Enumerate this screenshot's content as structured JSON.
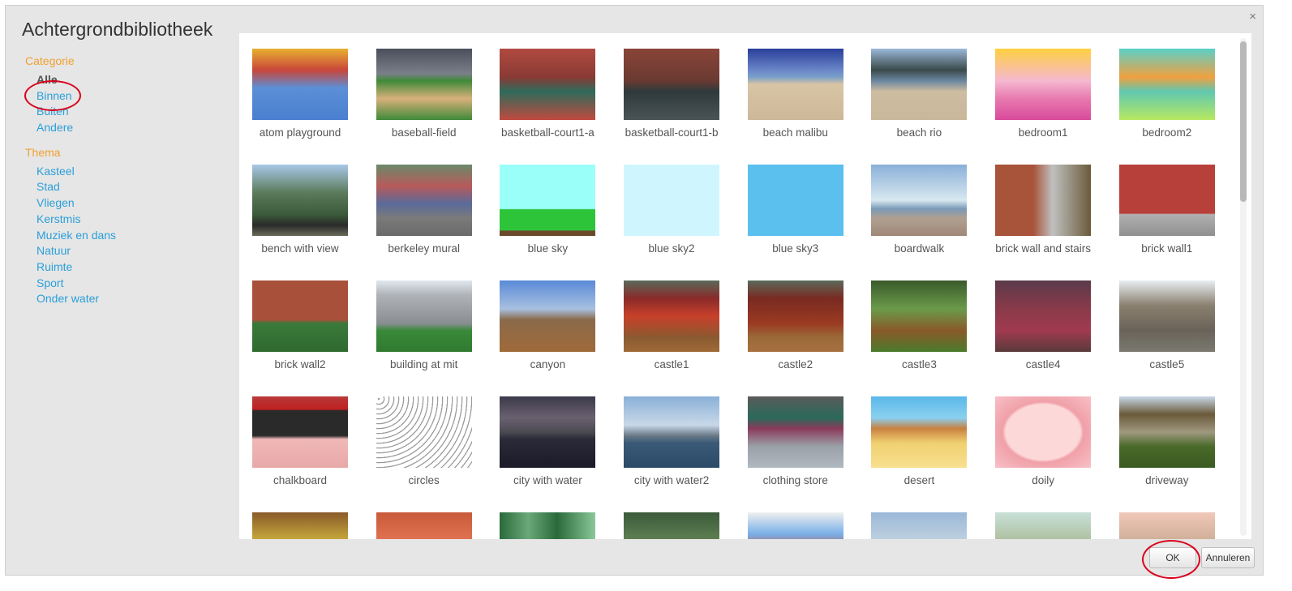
{
  "dialog": {
    "title": "Achtergrondbibliotheek",
    "close_glyph": "×",
    "ok_label": "OK",
    "cancel_label": "Annuleren"
  },
  "sidebar": {
    "category_heading": "Categorie",
    "categories": [
      "Alle",
      "Binnen",
      "Buiten",
      "Andere"
    ],
    "selected_category": "Alle",
    "theme_heading": "Thema",
    "themes": [
      "Kasteel",
      "Stad",
      "Vliegen",
      "Kerstmis",
      "Muziek en dans",
      "Natuur",
      "Ruimte",
      "Sport",
      "Onder water"
    ]
  },
  "icons": {
    "close": "close-icon"
  },
  "colors": {
    "heading_orange": "#f0a030",
    "link_blue": "#2a9fd8",
    "annotation_red": "#d9001b"
  },
  "backdrops": [
    {
      "label": "atom playground",
      "bg": "linear-gradient(180deg,#e8b030 0%,#c9463a 30%,#5b8fd6 55%,#4a7fcf 100%)"
    },
    {
      "label": "baseball-field",
      "bg": "linear-gradient(180deg,#4a4f5c 0%,#7a7f88 35%,#3f8a3a 45%,#d9b07a 70%,#3f8a3a 100%)"
    },
    {
      "label": "basketball-court1-a",
      "bg": "linear-gradient(180deg,#b04a40 0%,#8a3a35 40%,#2e6b5a 60%,#c04a40 100%)"
    },
    {
      "label": "basketball-court1-b",
      "bg": "linear-gradient(180deg,#8a4438 0%,#6a3a32 45%,#2f3a3c 60%,#4a5456 100%)"
    },
    {
      "label": "beach malibu",
      "bg": "linear-gradient(180deg,#2a3f9a 0%,#6a86c8 30%,#7aa0c8 40%,#d8c5a5 50%,#cdb89a 100%)"
    },
    {
      "label": "beach rio",
      "bg": "linear-gradient(180deg,#9ab8d8 0%,#3a4a4a 30%,#6a86a0 45%,#cdbca0 60%,#c8b89a 100%)"
    },
    {
      "label": "bedroom1",
      "bg": "linear-gradient(180deg,#ffd040 0%,#f5b8d0 45%,#e87ab0 70%,#d84a9a 100%)"
    },
    {
      "label": "bedroom2",
      "bg": "linear-gradient(180deg,#5ad0c8 0%,#f0a040 40%,#60c8b0 60%,#b8e860 100%)"
    },
    {
      "label": "bench with view",
      "bg": "linear-gradient(180deg,#a8c8e8 0%,#5a7a5a 40%,#3a5a3a 70%,#2a2a2a 85%,#6a6a5a 100%)"
    },
    {
      "label": "berkeley mural",
      "bg": "linear-gradient(180deg,#6a8a6a 0%,#b85a5a 30%,#5a6a9a 55%,#7a7a7a 75%,#6a6a6a 100%)"
    },
    {
      "label": "blue sky",
      "bg": "linear-gradient(180deg,#9afff8 0%,#9afff8 62%,#2ec43a 63%,#2ec43a 92%,#6a4a2a 93%)"
    },
    {
      "label": "blue sky2",
      "bg": "#cff6ff"
    },
    {
      "label": "blue sky3",
      "bg": "#5bc0ee"
    },
    {
      "label": "boardwalk",
      "bg": "linear-gradient(180deg,#8ab0d8 0%,#d8e8f0 50%,#7a9ab8 62%,#b0a090 75%,#a08878 100%)"
    },
    {
      "label": "brick wall and stairs",
      "bg": "linear-gradient(90deg,#a8543a 0%,#a8543a 40%,#c0c0c0 60%,#6a5a3a 100%)"
    },
    {
      "label": "brick wall1",
      "bg": "linear-gradient(180deg,#b8403a 0%,#b8403a 68%,#b0b0b0 70%,#909090 100%)"
    },
    {
      "label": "brick wall2",
      "bg": "linear-gradient(180deg,#a8503a 0%,#a8503a 55%,#3a7a3a 60%,#2f6a2f 100%)"
    },
    {
      "label": "building at mit",
      "bg": "linear-gradient(180deg,#e0e8f0 0%,#b0b4b8 20%,#8a8e92 60%,#3a8a3a 70%,#2f7a2f 100%)"
    },
    {
      "label": "canyon",
      "bg": "linear-gradient(180deg,#5a8ad8 0%,#a8c0e0 40%,#8a6a4a 55%,#a06a3a 100%)"
    },
    {
      "label": "castle1",
      "bg": "linear-gradient(180deg,#5a6a5a 0%,#8a2a2a 25%,#c8402a 50%,#8a5a30 80%,#a06a38 100%)"
    },
    {
      "label": "castle2",
      "bg": "linear-gradient(180deg,#5a6a5a 0%,#7a2a22 25%,#9a3a22 60%,#9a6a38 80%,#a87040 100%)"
    },
    {
      "label": "castle3",
      "bg": "linear-gradient(180deg,#3a5a2a 0%,#6a9a4a 40%,#8a5a2a 70%,#4a7a2a 100%)"
    },
    {
      "label": "castle4",
      "bg": "linear-gradient(180deg,#5a3a4a 0%,#8a3a4a 40%,#a03a50 70%,#5a3a3a 100%)"
    },
    {
      "label": "castle5",
      "bg": "linear-gradient(180deg,#e8eef2 0%,#8a8070 35%,#6a6258 70%,#7a7a70 100%)"
    },
    {
      "label": "chalkboard",
      "bg": "linear-gradient(180deg,#b83a3a 0%,#c02020 18%,#2a2a2a 20%,#2a2a2a 55%,#f0b8b8 60%,#e8a8a8 100%)"
    },
    {
      "label": "circles",
      "bg": "repeating-radial-gradient(circle at 3px 3px,#999 0,#999 1px,#fff 1.5px,#fff 6px)"
    },
    {
      "label": "city with water",
      "bg": "linear-gradient(180deg,#3a3a4a 0%,#6a6070 30%,#4a4a50 50%,#2a2a38 60%,#1a1a28 100%)"
    },
    {
      "label": "city with water2",
      "bg": "linear-gradient(180deg,#8ab0d8 0%,#c8d8e8 40%,#6a7a88 55%,#3a5a78 65%,#2a4a68 100%)"
    },
    {
      "label": "clothing store",
      "bg": "linear-gradient(180deg,#5a5a5a 0%,#2a6a5a 30%,#8a3a5a 45%,#9aa0a8 70%,#b0b8c0 100%)"
    },
    {
      "label": "desert",
      "bg": "linear-gradient(180deg,#5ab8e8 0%,#8ad0f0 30%,#c88040 45%,#f0d070 65%,#f8e090 100%)"
    },
    {
      "label": "doily",
      "bg": "radial-gradient(ellipse at center,#fcd8d8 0%,#fcd8d8 55%,#f0a0a8 60%,#f8c0c8 100%)"
    },
    {
      "label": "driveway",
      "bg": "linear-gradient(180deg,#c8d8e8 0%,#6a5a3a 25%,#a09880 50%,#4a6a2a 70%,#3a5a20 100%)"
    },
    {
      "label": "",
      "bg": "linear-gradient(180deg,#8a5a2a 0%,#d8c040 50%,#3a7a2a 100%)"
    },
    {
      "label": "",
      "bg": "linear-gradient(180deg,#c85a3a 0%,#e87a5a 50%,#5a8a3a 100%)"
    },
    {
      "label": "",
      "bg": "linear-gradient(90deg,#2a6a3a 0%,#6aa87a 30%,#2a6a3a 60%,#8ac89a 100%)"
    },
    {
      "label": "",
      "bg": "linear-gradient(180deg,#3a5a3a 0%,#6a8a5a 50%,#4a6a4a 100%)"
    },
    {
      "label": "",
      "bg": "linear-gradient(180deg,#f0f0f0 0%,#7ab0e8 30%,#c84a3a 60%,#a8c8e8 100%)"
    },
    {
      "label": "",
      "bg": "linear-gradient(180deg,#9ab8d8 0%,#c8d8e0 50%,#a0b0b8 100%)"
    },
    {
      "label": "",
      "bg": "linear-gradient(180deg,#c8e0d8 0%,#a8b890 50%,#8a9a70 100%)"
    },
    {
      "label": "",
      "bg": "linear-gradient(180deg,#f0c8b8 0%,#c8a890 50%,#e89898 100%)"
    }
  ]
}
